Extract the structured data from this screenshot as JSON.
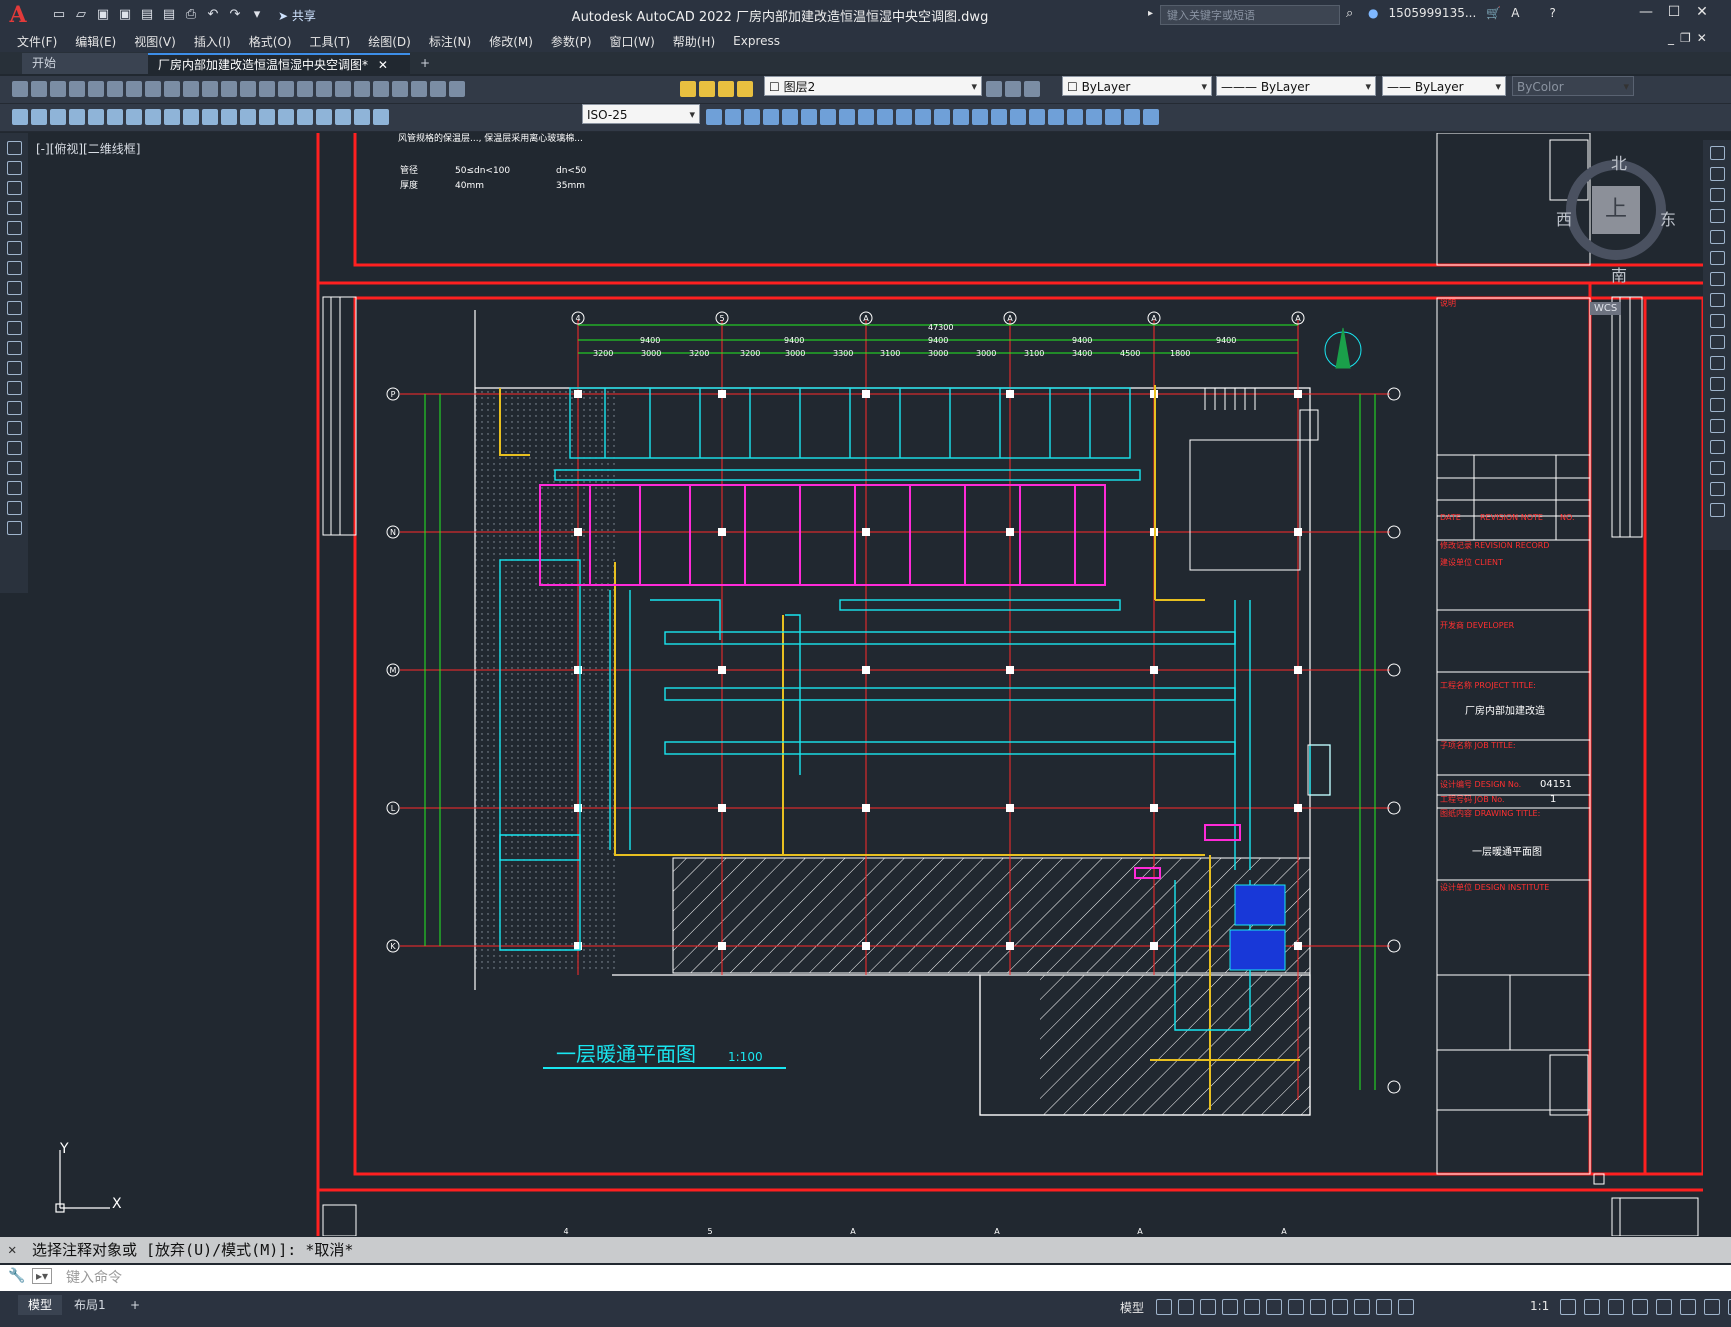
{
  "app": {
    "logo": "A",
    "title": "Autodesk AutoCAD 2022   厂房内部加建改造恒温恒湿中央空调图.dwg",
    "share_label": "共享",
    "search_placeholder": "键入关键字或短语",
    "user": "1505999135...",
    "accent_color": "#e23a3a"
  },
  "menu": [
    "文件(F)",
    "编辑(E)",
    "视图(V)",
    "插入(I)",
    "格式(O)",
    "工具(T)",
    "绘图(D)",
    "标注(N)",
    "修改(M)",
    "参数(P)",
    "窗口(W)",
    "帮助(H)",
    "Express"
  ],
  "tabs": {
    "start": "开始",
    "active": "厂房内部加建改造恒温恒湿中央空调图*",
    "new": "+"
  },
  "toolbar": {
    "layer": "图层2",
    "color": "ByLayer",
    "linetype": "ByLayer",
    "lineweight": "ByLayer",
    "plotstyle": "ByColor",
    "dimstyle": "ISO-25"
  },
  "viewport": {
    "label": "[-][俯视][二维线框]"
  },
  "viewcube": {
    "north": "北",
    "south": "南",
    "east": "东",
    "west": "西",
    "top": "上",
    "wcs": "WCS"
  },
  "drawing": {
    "title": "一层暖通平面图",
    "scale": "1:100",
    "total_dim": "47300",
    "top_dims": [
      "9400",
      "9400",
      "9400",
      "9400",
      "9400"
    ],
    "sub_dims": [
      "3200",
      "3000",
      "3200",
      "3200",
      "3000",
      "3300",
      "3100",
      "3000",
      "3000",
      "3100",
      "3400",
      "4500",
      "1800"
    ],
    "col_bubbles": [
      "4",
      "5",
      "A",
      "A",
      "A",
      "A"
    ],
    "row_bubbles": [
      "P",
      "N",
      "M",
      "L",
      "K"
    ],
    "notes": [
      "风管规格的保温层..., 保温层采用离心玻璃棉...",
      "管径",
      "厚度",
      "50≤dn<100",
      "40mm",
      "dn<50",
      "35mm"
    ],
    "title_block": {
      "revision": "修改记录 REVISION RECORD",
      "client": "建设单位 CLIENT",
      "developer": "开发商 DEVELOPER",
      "project_title": "工程名称 PROJECT TITLE:",
      "project_name": "厂房内部加建改造",
      "job_title": "子项名称 JOB TITLE:",
      "design_no_label": "设计编号 DESIGN No.",
      "design_no": "04151",
      "job_no_label": "工程号码 JOB No.",
      "job_no": "1",
      "drawing_title_label": "图纸内容 DRAWING TITLE:",
      "drawing_title": "一层暖通平面图",
      "institute": "设计单位 DESIGN INSTITUTE",
      "date_label": "DATE",
      "revision_note": "REVISION NOTE",
      "no_label": "NO."
    }
  },
  "command": {
    "history": "选择注释对象或 [放弃(U)/模式(M)]: *取消*",
    "placeholder": "键入命令"
  },
  "layouts": [
    "模型",
    "布局1",
    "+"
  ],
  "status": {
    "model": "模型",
    "scale": "1:1"
  }
}
